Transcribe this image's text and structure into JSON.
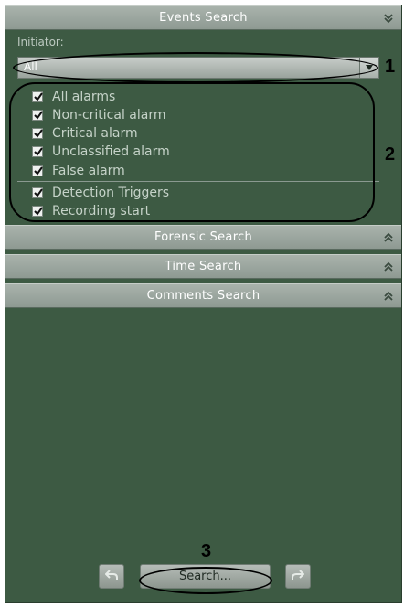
{
  "panel": {
    "events_search": {
      "title": "Events Search",
      "initiator_label": "Initiator:",
      "initiator_value": "All",
      "checkbox_groups": [
        [
          {
            "label": "All alarms",
            "checked": true
          },
          {
            "label": "Non-critical alarm",
            "checked": true
          },
          {
            "label": "Critical alarm",
            "checked": true
          },
          {
            "label": "Unclassified alarm",
            "checked": true
          },
          {
            "label": "False alarm",
            "checked": true
          }
        ],
        [
          {
            "label": "Detection Triggers",
            "checked": true
          },
          {
            "label": "Recording start",
            "checked": true
          }
        ]
      ]
    },
    "sections": [
      {
        "title": "Forensic Search"
      },
      {
        "title": "Time Search"
      },
      {
        "title": "Comments Search"
      }
    ],
    "footer": {
      "search_label": "Search...",
      "back_icon": "undo-arrow-icon",
      "forward_icon": "redo-arrow-icon"
    }
  },
  "annotations": {
    "callout_1": "1",
    "callout_2": "2",
    "callout_3": "3"
  },
  "colors": {
    "panel_bg": "#3d5a43",
    "header_bg": "#9aa59e",
    "text_light": "#c6d3c9"
  }
}
